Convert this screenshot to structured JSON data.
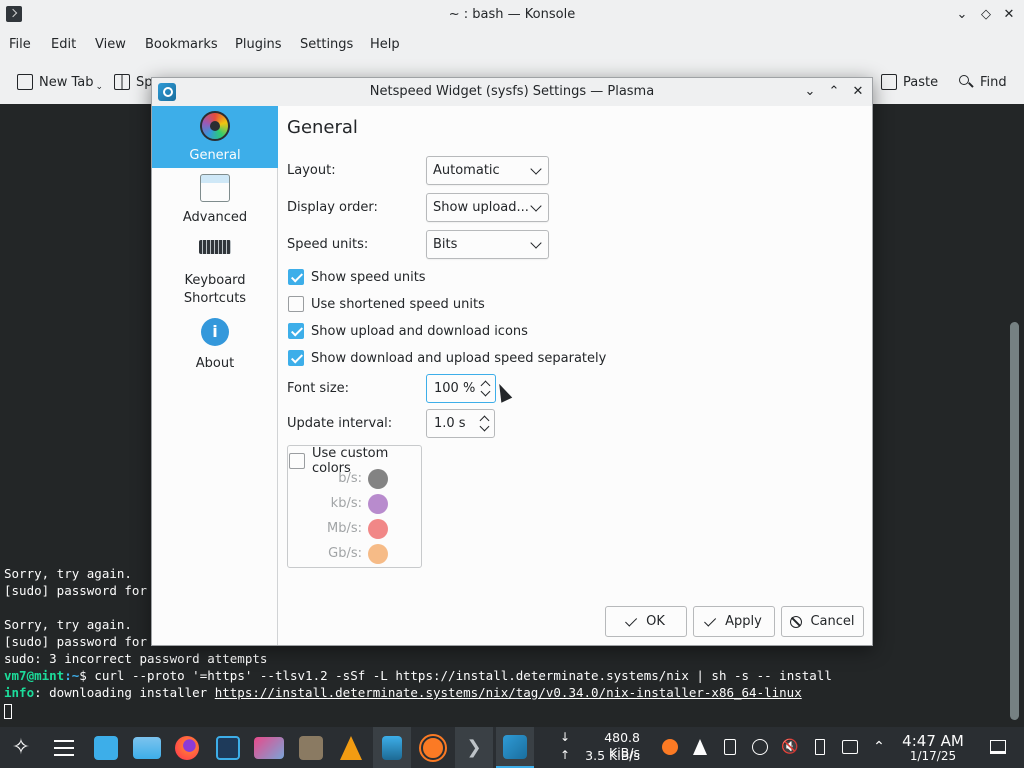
{
  "konsole": {
    "title": "~ : bash — Konsole",
    "menu": [
      "File",
      "Edit",
      "View",
      "Bookmarks",
      "Plugins",
      "Settings",
      "Help"
    ],
    "toolbar": {
      "new_tab": "New Tab",
      "split_partial": "Sp",
      "paste": "Paste",
      "find": "Find"
    },
    "terminal": {
      "lines": [
        "Sorry, try again.",
        "[sudo] password for",
        "",
        "Sorry, try again.",
        "[sudo] password for",
        "sudo: 3 incorrect password attempts"
      ],
      "prompt_user": "vm7@mint",
      "prompt_path": ":~",
      "prompt_cmd": "$ curl --proto '=https' --tlsv1.2 -sSf -L https://install.determinate.systems/nix | sh -s -- install",
      "info_word": "info",
      "info_text": ": downloading installer ",
      "info_link": "https://install.determinate.systems/nix/tag/v0.34.0/nix-installer-x86_64-linux"
    }
  },
  "dialog": {
    "title": "Netspeed Widget (sysfs) Settings — Plasma",
    "sidebar": [
      {
        "label": "General",
        "icon": "color-wheel-icon",
        "active": true
      },
      {
        "label": "Advanced",
        "icon": "window-icon",
        "active": false
      },
      {
        "label": "Keyboard\nShortcuts",
        "icon": "keyboard-icon",
        "active": false
      },
      {
        "label": "About",
        "icon": "info-icon",
        "active": false
      }
    ],
    "heading": "General",
    "layout_label": "Layout:",
    "layout_value": "Automatic",
    "order_label": "Display order:",
    "order_value": "Show upload...",
    "units_label": "Speed units:",
    "units_value": "Bits",
    "checks": [
      {
        "label": "Show speed units",
        "checked": true
      },
      {
        "label": "Use shortened speed units",
        "checked": false
      },
      {
        "label": "Show upload and download icons",
        "checked": true
      },
      {
        "label": "Show download and upload speed separately",
        "checked": true
      }
    ],
    "font_size_label": "Font size:",
    "font_size_value": "100 %",
    "interval_label": "Update interval:",
    "interval_value": "1.0 s",
    "custom_colors_label": "Use custom colors",
    "custom_colors_checked": false,
    "colors": [
      {
        "label": "b/s:",
        "color": "#767676"
      },
      {
        "label": "kb/s:",
        "color": "#b07ec8"
      },
      {
        "label": "Mb/s:",
        "color": "#f07a7a"
      },
      {
        "label": "Gb/s:",
        "color": "#f5b47a"
      }
    ],
    "buttons": {
      "ok": "OK",
      "apply": "Apply",
      "cancel": "Cancel"
    }
  },
  "taskbar": {
    "download_speed": "480.8 KiB/s",
    "upload_speed": "3.5 KiB/s",
    "down_arrow": "↓",
    "up_arrow": "↑",
    "time": "4:47 AM",
    "date": "1/17/25",
    "accent": "#3daee9"
  }
}
